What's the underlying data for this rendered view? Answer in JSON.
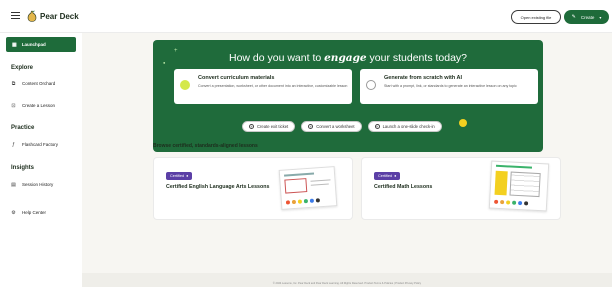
{
  "header": {
    "app_name": "Pear Deck",
    "open_file_label": "Open existing file",
    "create_label": "Create"
  },
  "sidebar": {
    "launchpad_label": "Launchpad",
    "explore_heading": "Explore",
    "content_orchard_label": "Content Orchard",
    "create_lesson_label": "Create a Lesson",
    "practice_heading": "Practice",
    "flashcard_factory_label": "Flashcard Factory",
    "insights_heading": "Insights",
    "session_history_label": "Session History",
    "help_center_label": "Help Center"
  },
  "hero": {
    "title_pre": "How do you want to ",
    "title_em": "engage",
    "title_post": " your students today?",
    "cards": [
      {
        "title": "Convert curriculum materials",
        "description": "Convert a presentation, worksheet, or other document into an interactive, customizable lesson"
      },
      {
        "title": "Generate from scratch with AI",
        "description": "Start with a prompt, link, or standards to generate an interactive lesson on any topic"
      }
    ]
  },
  "chips": [
    {
      "label": "Create exit ticket"
    },
    {
      "label": "Convert a worksheet"
    },
    {
      "label": "Launch a one-slide check-in"
    }
  ],
  "browse": {
    "heading": "Browse certified, standards-aligned lessons",
    "cards": [
      {
        "badge": "Certified",
        "title": "Certified English Language Arts Lessons"
      },
      {
        "badge": "Certified",
        "title": "Certified Math Lessons"
      }
    ]
  },
  "footer": {
    "text": "© 2024 Lessons, Inc. Pear Deck and Pear Deck Learning. All Rights Reserved. Product Terms & Policies | Product Privacy Policy"
  },
  "colors": {
    "brand_green": "#1e6b3a",
    "certified_purple": "#5b3fa6",
    "badge_yellow": "#f3d020"
  },
  "icons": [
    "hamburger-icon",
    "pear-deck-logo",
    "magic-wand-icon",
    "launchpad-icon",
    "content-orchard-icon",
    "create-lesson-icon",
    "flashcard-icon",
    "session-history-icon",
    "help-icon",
    "plus-circle-icon",
    "sparkle-icon"
  ]
}
